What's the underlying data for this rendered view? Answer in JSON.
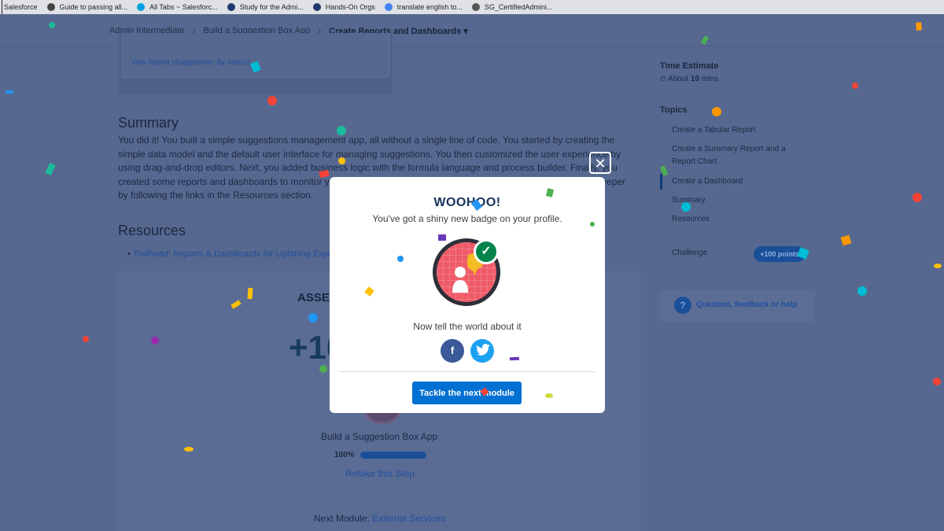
{
  "bookmarks": [
    {
      "label": "Salesforce",
      "color": ""
    },
    {
      "label": "Guide to passing all...",
      "color": "#444444"
    },
    {
      "label": "All Tabs ~ Salesforc...",
      "color": "#00a1e0"
    },
    {
      "label": "Study for the Admi...",
      "color": "#1f3a6b"
    },
    {
      "label": "Hands-On Orgs",
      "color": "#1f3a6b"
    },
    {
      "label": "translate english to...",
      "color": "#4285f4"
    },
    {
      "label": "SG_CertifiedAdmini...",
      "color": "#555555"
    }
  ],
  "breadcrumb": {
    "items": [
      "Admin Intermediate",
      "Build a Suggestion Box App"
    ],
    "current": "Create Reports and Dashboards ▾"
  },
  "card": {
    "view_report": "View Report (Suggestions: By Status)"
  },
  "summary": {
    "title": "Summary",
    "text": "You did it! You built a simple suggestions management app, all without a single line of code. You started by creating the simple data model and the default user interface for managing suggestions. You then customized the user experience by using drag-and-drop editors. Next, you added business logic with the formula language and process builder. Finally, you created some reports and dashboards to monitor your data. Check out the links in the Resources section and dive deeper by following the links in the Resources section."
  },
  "resources": {
    "title": "Resources",
    "item_italic": "Trailhead:",
    "item_link": " Reports & Dashboards for Lightning Experience"
  },
  "assessment": {
    "label": "ASSESSMENT",
    "points": "+100",
    "step_name": "Build a Suggestion Box App",
    "progress_text": "100%",
    "progress_fraction": 1.0,
    "retake": "Retake this Step",
    "next_module_label": "Next Module: ",
    "next_module_link": "External Services"
  },
  "sidebar": {
    "time_heading": "Time Estimate",
    "time_prefix": "⏲ About ",
    "time_value": "10",
    "time_suffix": " mins",
    "topics_heading": "Topics",
    "topics": [
      "Create a Tabular Report",
      "Create a Summary Report and a Report Chart",
      "Create a Dashboard",
      "Summary",
      "Resources"
    ],
    "challenge_label": "Challenge",
    "challenge_points": "+100 points",
    "help_text": "Question, feedback or help"
  },
  "modal": {
    "close": "✕",
    "title": "WOOHOO!",
    "subtitle": "You've got a shiny new badge on your profile.",
    "tell": "Now tell the world about it",
    "facebook": "f",
    "twitter": "t",
    "next_button": "Tackle the next module"
  },
  "colors": {
    "overlay": "#56688f",
    "button": "#0070d2",
    "badge": "#ef5a67",
    "check": "#04844b"
  }
}
